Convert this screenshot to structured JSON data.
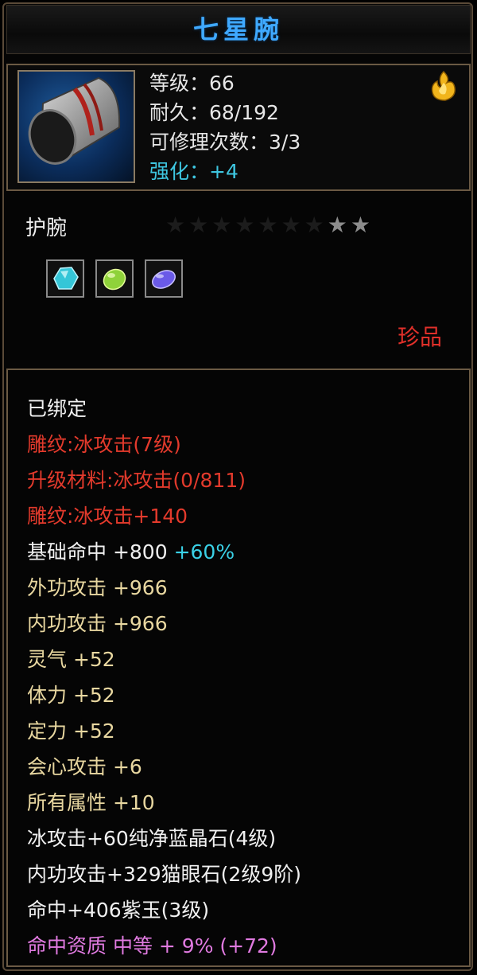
{
  "item": {
    "name": "七星腕",
    "level": "等级：66",
    "durability": "耐久：68/192",
    "repairs": "可修理次数：3/3",
    "enhance": "强化：+4",
    "type": "护腕",
    "rarity": "珍品",
    "icon": "bracer-icon",
    "badge_icon": "flame-badge-icon",
    "stars_total": 9,
    "stars_filled": 2,
    "gems": [
      {
        "name": "cyan-gem-icon",
        "color": "#35c6d8"
      },
      {
        "name": "green-gem-icon",
        "color": "#8fd23a"
      },
      {
        "name": "purple-gem-icon",
        "color": "#6a5ae8"
      }
    ]
  },
  "properties": {
    "bound": "已绑定",
    "engrave1": "雕纹:冰攻击(7级)",
    "upgrade_mat": "升级材料:冰攻击(0/811)",
    "engrave2": "雕纹:冰攻击+140",
    "hit_label": "基础命中 +800",
    "hit_bonus": "+60%",
    "ext_atk": "外功攻击 +966",
    "int_atk": "内功攻击 +966",
    "spirit": "灵气 +52",
    "stamina": "体力 +52",
    "focus": "定力 +52",
    "crit": "会心攻击 +6",
    "all_attr": "所有属性 +10",
    "gem1": "冰攻击+60纯净蓝晶石(4级)",
    "gem2": "内功攻击+329猫眼石(2级9阶)",
    "gem3": "命中+406紫玉(3级)",
    "aptitude": "命中资质 中等 + 9% (+72)"
  },
  "colors": {
    "title": "#3fa9ff",
    "red": "#e33a2c",
    "gold": "#e8d7a0",
    "cyan": "#3ad1e6",
    "pink": "#e07ae0",
    "border": "#6b5a44"
  }
}
